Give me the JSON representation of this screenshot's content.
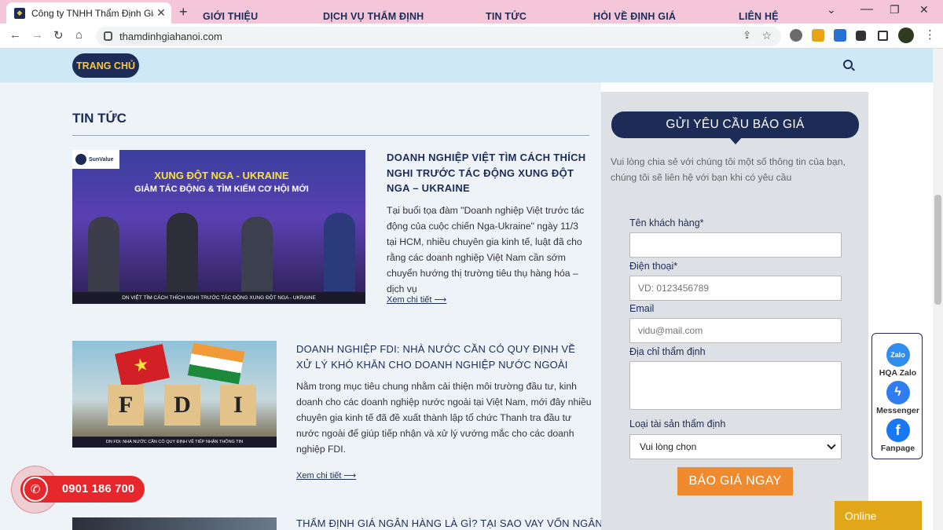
{
  "browser": {
    "tab_title": "Công ty TNHH Thẩm Định Giá Hà",
    "tab_close": "✕",
    "new_tab": "+",
    "url": "thamdinhgiahanoi.com",
    "win_min": "⌄",
    "win_restore": "❐",
    "win_close": "✕"
  },
  "nav": {
    "home": "TRANG CHỦ",
    "about": "GIỚI THIỆU",
    "services": "DỊCH VỤ THẨM ĐỊNH",
    "news": "TIN TỨC",
    "faq": "HỎI VỀ ĐỊNH GIÁ",
    "contact": "LIÊN HỆ"
  },
  "section_title": "TIN TỨC",
  "articles": [
    {
      "title": "DOANH NGHIỆP VIỆT TÌM CÁCH THÍCH NGHI TRƯỚC TÁC ĐỘNG XUNG ĐỘT NGA – UKRAINE",
      "excerpt": "Tại buổi tọa đàm \"Doanh nghiệp Việt trước tác động của cuộc chiến Nga-Ukraine\" ngày 11/3 tại HCM, nhiều chuyên gia kinh tế, luật đã cho rằng các doanh nghiệp Việt Nam cần sớm chuyển hướng thị trường tiêu thụ hàng hóa – dịch vụ",
      "more": "Xem chi tiết ⟶",
      "img_heading1": "XUNG ĐỘT NGA - UKRAINE",
      "img_heading2": "GIẢM TÁC ĐỘNG & TÌM KIẾM CƠ HỘI MỚI",
      "img_caption": "DN VIỆT TÌM CÁCH THÍCH NGHI TRƯỚC TÁC ĐỘNG XUNG ĐỘT NGA - UKRAINE",
      "img_logo": "SunValue"
    },
    {
      "title": "DOANH NGHIỆP FDI: NHÀ NƯỚC CẦN CÓ QUY ĐỊNH VỀ XỬ LÝ KHÓ KHĂN CHO DOANH NGHIỆP NƯỚC NGOÀI",
      "excerpt": "Nằm trong mục tiêu chung nhằm cải thiện môi trường đầu tư, kinh doanh cho các doanh nghiệp nước ngoài tại Việt Nam, mới đây nhiều chuyên gia kinh tế đã đề xuất thành lập tổ chức Thanh tra đầu tư nước ngoài để giúp tiếp nhận và xử lý vướng mắc cho các doanh nghiệp FDI.",
      "more": "Xem chi tiết ⟶",
      "img_letters": [
        "F",
        "D",
        "I"
      ],
      "img_caption": "DN FDI: NHÀ NƯỚC CẦN CÓ QUY ĐỊNH VỀ TIẾP NHẬN THÔNG TIN"
    },
    {
      "title": "THẨM ĐỊNH GIÁ NGÂN HÀNG LÀ GÌ? TẠI SAO VAY VỐN NGÂN"
    }
  ],
  "quote_form": {
    "heading": "GỬI YÊU CẦU BÁO GIÁ",
    "intro": "Vui lòng chia sẻ với chúng tôi một số thông tin của bạn, chúng tôi sẽ liên hệ với bạn khi có yêu cầu",
    "name_label": "Tên khách hàng*",
    "phone_label": "Điện thoại*",
    "phone_placeholder": "VD: 0123456789",
    "email_label": "Email",
    "email_placeholder": "vidu@mail.com",
    "address_label": "Địa chỉ thẩm định",
    "asset_label": "Loại tài sản thẩm định",
    "asset_selected": "Vui lòng chọn",
    "submit": "BÁO GIÁ NGAY"
  },
  "social": {
    "zalo": "HQA Zalo",
    "zalo_icon": "Zalo",
    "messenger": "Messenger",
    "facebook": "Fanpage"
  },
  "online": "Online",
  "hotline": "0901 186 700",
  "colors": {
    "navy": "#1d2c57",
    "gold": "#f7c93c",
    "orange": "#f08a2e",
    "red": "#e6282c",
    "nav_bg": "#cfe8f6"
  }
}
